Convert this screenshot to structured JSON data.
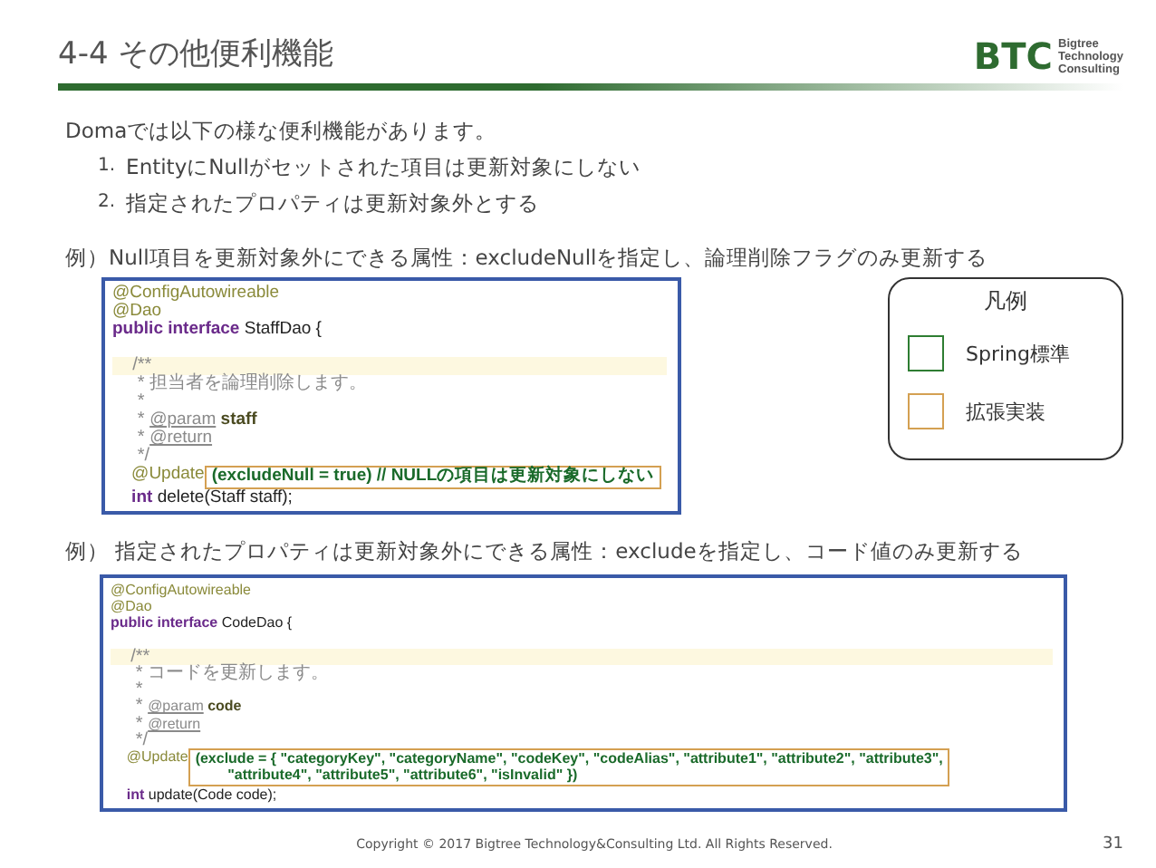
{
  "header": {
    "title": "4-4 その他便利機能",
    "logo": {
      "mark": "BTC",
      "lines": [
        "Bigtree",
        "Technology",
        "Consulting"
      ]
    }
  },
  "intro": "Domaでは以下の様な便利機能があります。",
  "features": [
    {
      "number": "1.",
      "text": "EntityにNullがセットされた項目は更新対象にしない"
    },
    {
      "number": "2.",
      "text": "指定されたプロパティは更新対象外とする"
    }
  ],
  "examples": [
    {
      "caption": "例）Null項目を更新対象外にできる属性：excludeNullを指定し、論理削除フラグのみ更新する",
      "code": [
        {
          "highlighted": false,
          "segments": [
            {
              "kind": "annotation",
              "text": "@ConfigAutowireable"
            }
          ]
        },
        {
          "highlighted": false,
          "segments": [
            {
              "kind": "annotation",
              "text": "@Dao"
            }
          ]
        },
        {
          "highlighted": false,
          "segments": [
            {
              "kind": "keyword",
              "text": "public interface "
            },
            {
              "kind": "plain",
              "text": "StaffDao {"
            }
          ]
        },
        {
          "highlighted": false
        },
        {
          "highlighted": true,
          "segments": [
            {
              "kind": "comment",
              "text": "    /**"
            }
          ]
        },
        {
          "highlighted": false,
          "segments": [
            {
              "kind": "comment",
              "text": "     * 担当者を論理削除します。"
            }
          ]
        },
        {
          "highlighted": false,
          "segments": [
            {
              "kind": "comment",
              "text": "     *"
            }
          ]
        },
        {
          "highlighted": false,
          "segments": [
            {
              "kind": "comment",
              "text": "     * "
            },
            {
              "kind": "tag",
              "text": "@param"
            },
            {
              "kind": "param",
              "text": " staff"
            }
          ]
        },
        {
          "highlighted": false,
          "segments": [
            {
              "kind": "comment",
              "text": "     * "
            },
            {
              "kind": "tag",
              "text": "@return"
            }
          ]
        },
        {
          "highlighted": false,
          "segments": [
            {
              "kind": "comment",
              "text": "     */"
            }
          ]
        },
        {
          "highlighted": false,
          "segments": [
            {
              "kind": "annotation",
              "text": "    @Update"
            },
            {
              "kind": "boxed",
              "text": "(excludeNull = true) // NULLの項目は更新対象にしない"
            }
          ]
        },
        {
          "highlighted": false,
          "segments": [
            {
              "kind": "keyword",
              "text": "    int "
            },
            {
              "kind": "plain",
              "text": "delete(Staff staff);"
            }
          ]
        }
      ]
    },
    {
      "caption": "例） 指定されたプロパティは更新対象外にできる属性：excludeを指定し、コード値のみ更新する",
      "code": [
        {
          "highlighted": false,
          "segments": [
            {
              "kind": "annotation",
              "text": "@ConfigAutowireable"
            }
          ]
        },
        {
          "highlighted": false,
          "segments": [
            {
              "kind": "annotation",
              "text": "@Dao"
            }
          ]
        },
        {
          "highlighted": false,
          "segments": [
            {
              "kind": "keyword",
              "text": "public interface "
            },
            {
              "kind": "plain",
              "text": "CodeDao {"
            }
          ]
        },
        {
          "highlighted": false
        },
        {
          "highlighted": true,
          "segments": [
            {
              "kind": "comment",
              "text": "    /**"
            }
          ]
        },
        {
          "highlighted": false,
          "segments": [
            {
              "kind": "comment",
              "text": "     * コードを更新します。"
            }
          ]
        },
        {
          "highlighted": false,
          "segments": [
            {
              "kind": "comment",
              "text": "     *"
            }
          ]
        },
        {
          "highlighted": false,
          "segments": [
            {
              "kind": "comment",
              "text": "     * "
            },
            {
              "kind": "tag",
              "text": "@param"
            },
            {
              "kind": "param",
              "text": " code"
            }
          ]
        },
        {
          "highlighted": false,
          "segments": [
            {
              "kind": "comment",
              "text": "     * "
            },
            {
              "kind": "tag",
              "text": "@return"
            }
          ]
        },
        {
          "highlighted": false,
          "segments": [
            {
              "kind": "comment",
              "text": "     */"
            }
          ]
        },
        {
          "highlighted": false,
          "segments": [
            {
              "kind": "annotation",
              "text": "    @Update"
            },
            {
              "kind": "boxed",
              "text": "(exclude = { \"categoryKey\", \"categoryName\", \"codeKey\", \"codeAlias\", \"attribute1\", \"attribute2\", \"attribute3\",\n        \"attribute4\", \"attribute5\", \"attribute6\", \"isInvalid\" })"
            }
          ]
        },
        {
          "highlighted": false,
          "segments": [
            {
              "kind": "keyword",
              "text": "    int "
            },
            {
              "kind": "plain",
              "text": "update(Code code);"
            }
          ]
        }
      ]
    }
  ],
  "legend": {
    "title": "凡例",
    "items": [
      {
        "label": "Spring標準",
        "color": "#2e7d32"
      },
      {
        "label": "拡張実装",
        "color": "#d4a052"
      }
    ]
  },
  "footer": {
    "copyright": "Copyright © 2017 Bigtree Technology&Consulting Ltd. All Rights Reserved.",
    "page": "31"
  }
}
